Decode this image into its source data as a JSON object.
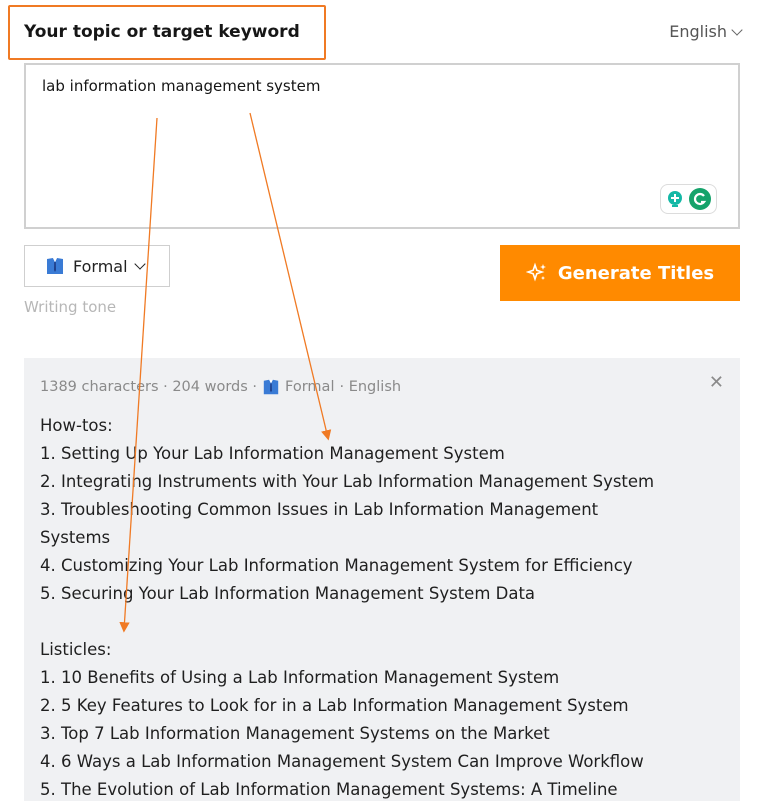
{
  "keyword_section": {
    "label": "Your topic or target keyword"
  },
  "language": {
    "selected": "English"
  },
  "keyword_input": {
    "value": "lab information management system"
  },
  "tone": {
    "selected": "Formal",
    "hint": "Writing tone"
  },
  "generate_button": {
    "label": "Generate Titles"
  },
  "result": {
    "meta_stats": "1389 characters · 204 words ·",
    "meta_tone": "Formal",
    "meta_language": "· English",
    "lines": [
      "How-tos:",
      "1. Setting Up Your Lab Information Management System",
      "2. Integrating Instruments with Your Lab Information Management System",
      "3. Troubleshooting Common Issues in Lab Information Management",
      "Systems",
      "4. Customizing Your Lab Information Management System for Efficiency",
      "5. Securing Your Lab Information Management System Data",
      "",
      "Listicles:",
      "1. 10 Benefits of Using a Lab Information Management System",
      "2. 5 Key Features to Look for in a Lab Information Management System",
      "3. Top 7 Lab Information Management Systems on the Market",
      "4. 6 Ways a Lab Information Management System Can Improve Workflow",
      "5. The Evolution of Lab Information Management Systems: A Timeline"
    ]
  },
  "colors": {
    "accent": "#ff8a00",
    "annotation": "#f07a24",
    "panel_bg": "#f0f1f3"
  }
}
